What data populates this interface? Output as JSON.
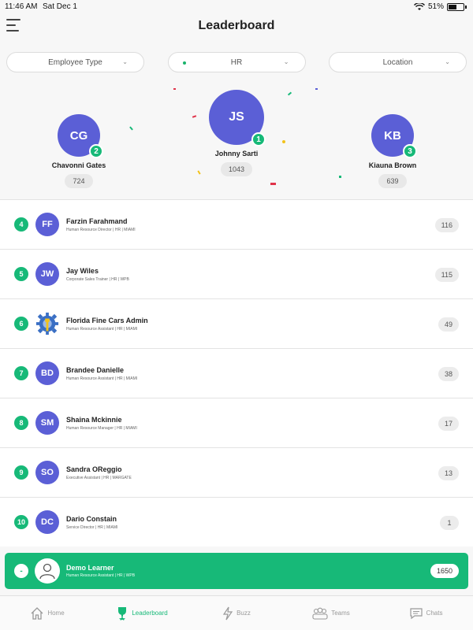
{
  "status": {
    "time": "11:46 AM",
    "date": "Sat Dec 1",
    "battery": "51%"
  },
  "header": {
    "title": "Leaderboard"
  },
  "filters": {
    "employee_type": "Employee Type",
    "department": "HR",
    "location": "Location"
  },
  "podium": [
    {
      "initials": "CG",
      "rank": "2",
      "name": "Chavonni Gates",
      "score": "724"
    },
    {
      "initials": "JS",
      "rank": "1",
      "name": "Johnny Sarti",
      "score": "1043"
    },
    {
      "initials": "KB",
      "rank": "3",
      "name": "Kiauna Brown",
      "score": "639"
    }
  ],
  "list": [
    {
      "rank": "4",
      "initials": "FF",
      "name": "Farzin Farahmand",
      "sub": "Human Resource Director | HR | MIAMI",
      "points": "116"
    },
    {
      "rank": "5",
      "initials": "JW",
      "name": "Jay Wiles",
      "sub": "Corporate Sales Trainer | HR | WPB",
      "points": "115"
    },
    {
      "rank": "6",
      "initials": "",
      "name": "Florida Fine Cars Admin",
      "sub": "Human Resource Assistant | HR | MIAMI",
      "points": "49"
    },
    {
      "rank": "7",
      "initials": "BD",
      "name": "Brandee Danielle",
      "sub": "Human Resource Assistant | HR | MIAMI",
      "points": "38"
    },
    {
      "rank": "8",
      "initials": "SM",
      "name": "Shaina Mckinnie",
      "sub": "Human Resource Manager | HR | MIAMI",
      "points": "17"
    },
    {
      "rank": "9",
      "initials": "SO",
      "name": "Sandra OReggio",
      "sub": "Executive Assistant | HR | MARGATE",
      "points": "13"
    },
    {
      "rank": "10",
      "initials": "DC",
      "name": "Dario Constain",
      "sub": "Service Director | HR | MIAMI",
      "points": "1"
    }
  ],
  "me": {
    "rank": "-",
    "name": "Demo Learner",
    "sub": "Human Resource Assistant | HR | WPB",
    "points": "1650"
  },
  "tabs": [
    {
      "label": "Home",
      "icon": "home-icon"
    },
    {
      "label": "Leaderboard",
      "icon": "trophy-icon"
    },
    {
      "label": "Buzz",
      "icon": "lightning-icon"
    },
    {
      "label": "Teams",
      "icon": "teams-icon"
    },
    {
      "label": "Chats",
      "icon": "chat-icon"
    }
  ],
  "colors": {
    "accent": "#17b978",
    "avatar": "#5b5fd6"
  }
}
